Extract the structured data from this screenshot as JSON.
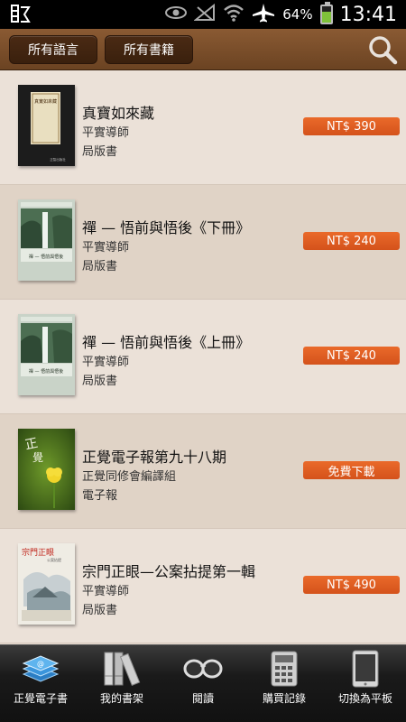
{
  "status_bar": {
    "battery_text": "64%",
    "battery_level": 0.64,
    "time": "13:41"
  },
  "toolbar": {
    "language_filter": "所有語言",
    "book_filter": "所有書籍"
  },
  "books": [
    {
      "title": "真寶如來藏",
      "author": "平實導師",
      "category": "局版書",
      "price": "NT$ 390"
    },
    {
      "title": "禪 — 悟前與悟後《下冊》",
      "author": "平實導師",
      "category": "局版書",
      "price": "NT$ 240"
    },
    {
      "title": "禪 — 悟前與悟後《上冊》",
      "author": "平實導師",
      "category": "局版書",
      "price": "NT$ 240"
    },
    {
      "title": "正覺電子報第九十八期",
      "author": "正覺同修會編譯組",
      "category": "電子報",
      "price": "免費下載"
    },
    {
      "title": "宗門正眼—公案拈提第一輯",
      "author": "平實導師",
      "category": "局版書",
      "price": "NT$ 490"
    }
  ],
  "covers": {
    "book1": "真實如來藏",
    "book1_pub": "正智出版社",
    "book5": "宗門正眼",
    "book5_sub": "公案拈提"
  },
  "nav": [
    {
      "label": "正覺電子書",
      "icon": "ebook-stack-icon"
    },
    {
      "label": "我的書架",
      "icon": "bookshelf-icon"
    },
    {
      "label": "閱讀",
      "icon": "reading-glasses-icon"
    },
    {
      "label": "購買記錄",
      "icon": "calculator-icon"
    },
    {
      "label": "切換為平板",
      "icon": "tablet-icon"
    }
  ]
}
